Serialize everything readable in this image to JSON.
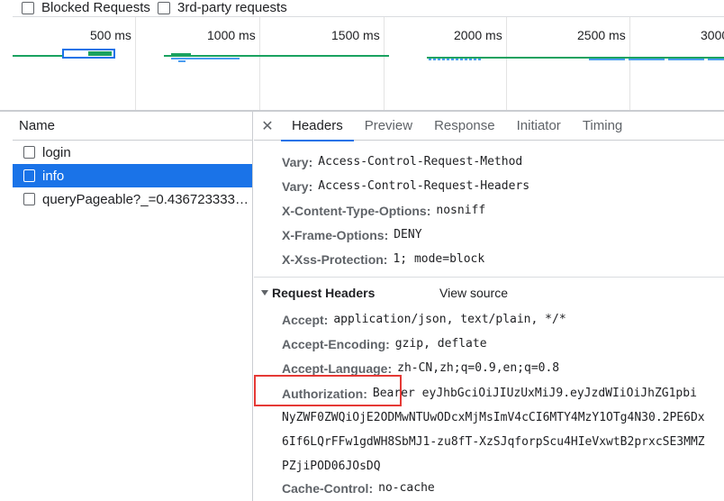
{
  "filters": {
    "blocked_requests": "Blocked Requests",
    "third_party": "3rd-party requests"
  },
  "overview": {
    "ticks": [
      "500 ms",
      "1000 ms",
      "1500 ms",
      "2000 ms",
      "2500 ms",
      "3000"
    ],
    "colors": {
      "green": "#1aa260",
      "blue": "#1a73e8",
      "lightblue": "#4a9cf0"
    }
  },
  "request_list": {
    "header": "Name",
    "items": [
      {
        "name": "login",
        "selected": false
      },
      {
        "name": "info",
        "selected": true
      },
      {
        "name": "queryPageable?_=0.4367233330...",
        "selected": false
      }
    ]
  },
  "details": {
    "tabs": [
      "Headers",
      "Preview",
      "Response",
      "Initiator",
      "Timing"
    ],
    "active_tab": "Headers",
    "response_headers": [
      {
        "name": "Vary:",
        "value": "Access-Control-Request-Method"
      },
      {
        "name": "Vary:",
        "value": "Access-Control-Request-Headers"
      },
      {
        "name": "X-Content-Type-Options:",
        "value": "nosniff"
      },
      {
        "name": "X-Frame-Options:",
        "value": "DENY"
      },
      {
        "name": "X-Xss-Protection:",
        "value": "1; mode=block"
      }
    ],
    "request_section_title": "Request Headers",
    "view_source": "View source",
    "request_headers": [
      {
        "name": "Accept:",
        "value": "application/json, text/plain, */*"
      },
      {
        "name": "Accept-Encoding:",
        "value": "gzip, deflate"
      },
      {
        "name": "Accept-Language:",
        "value": "zh-CN,zh;q=0.9,en;q=0.8"
      },
      {
        "name": "Authorization:",
        "value": "Bearer eyJhbGciOiJIUzUxMiJ9.eyJzdWIiOiJhZG1pbi"
      }
    ],
    "authorization_cont": [
      "NyZWF0ZWQiOjE2ODMwNTUwODcxMjMsImV4cCI6MTY4MzY1OTg4N30.2PE6Dx",
      "6If6LQrFFw1gdWH8SbMJ1-zu8fT-XzSJqforpScu4HIeVxwtB2prxcSE3MMZ",
      "PZjiPOD06JOsDQ"
    ],
    "cache_control": {
      "name": "Cache-Control:",
      "value": "no-cache"
    }
  }
}
